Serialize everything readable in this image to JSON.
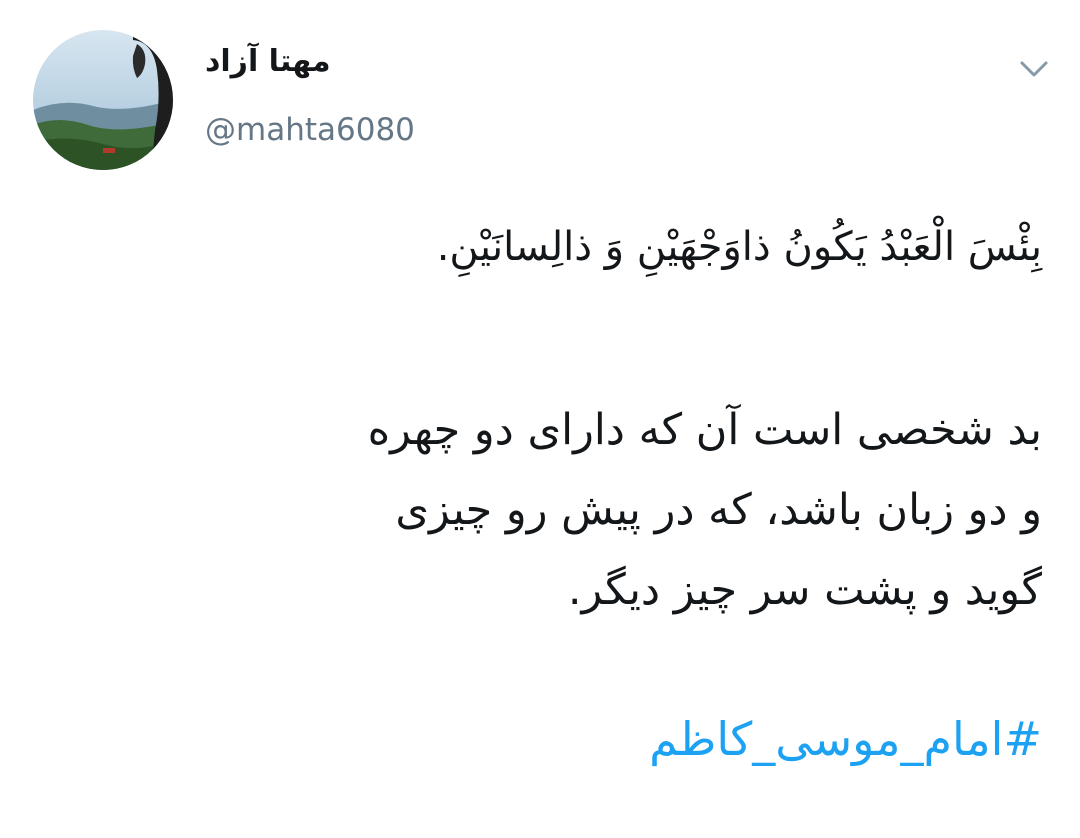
{
  "tweet": {
    "author": {
      "display_name": "مهتا آزاد",
      "handle": "@mahta6080",
      "avatar_icon": "avatar-photo"
    },
    "menu_icon": "chevron-down-icon",
    "text": {
      "line1": "بِئْسَ الْعَبْدُ يَكُونُ ذاوَجْهَيْنِ وَ ذالِسانَيْنِ.",
      "paragraph2_lines": [
        "بد شخصی است آن که دارای دو چهره",
        "و دو زبان باشد، که در پیش رو چیزی",
        "گوید و پشت سر چیز دیگر."
      ]
    },
    "hashtag": "#امام_موسی_کاظم"
  },
  "colors": {
    "text_primary": "#14171a",
    "text_secondary": "#657786",
    "link": "#1da1f2",
    "background": "#ffffff"
  }
}
